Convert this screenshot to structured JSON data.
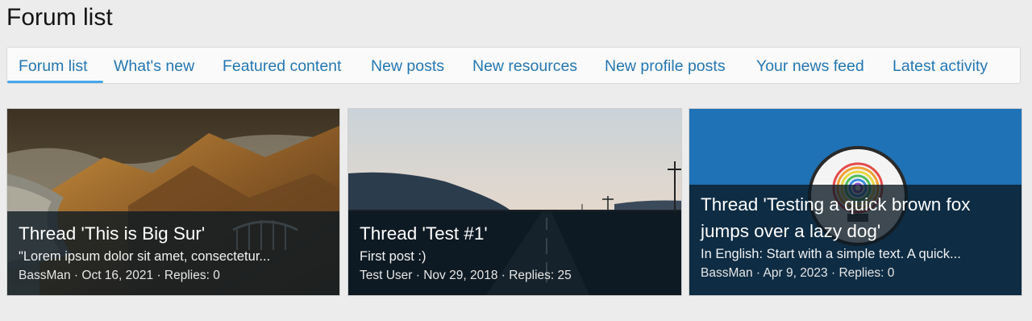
{
  "page": {
    "title": "Forum list"
  },
  "tabs": [
    {
      "label": "Forum list",
      "active": true
    },
    {
      "label": "What's new"
    },
    {
      "label": "Featured content"
    },
    {
      "label": "New posts"
    },
    {
      "label": "New resources"
    },
    {
      "label": "New profile posts"
    },
    {
      "label": "Your news feed"
    },
    {
      "label": "Latest activity"
    }
  ],
  "cards": [
    {
      "title": "Thread 'This is Big Sur'",
      "snippet": "\"Lorem ipsum dolor sit amet, consectetur...",
      "meta": "BassMan · Oct 16, 2021 · Replies: 0",
      "image": "mountain-coast-landscape"
    },
    {
      "title": "Thread 'Test #1'",
      "snippet": "First post :)",
      "meta": "Test User · Nov 29, 2018 · Replies: 25",
      "image": "road-at-sunset"
    },
    {
      "title_line1": "Thread 'Testing a quick brown fox",
      "title_line2": "jumps over a lazy dog'",
      "snippet": "In English: Start with a simple text. A quick...",
      "meta": "BassMan · Apr 9, 2023 · Replies: 0",
      "image": "lightbulb-fingerprint-logo"
    }
  ],
  "colors": {
    "background": "#ececec",
    "link": "#2577b1",
    "tab_underline": "#47a7eb",
    "card3_bg": "#1f72b5",
    "overlay": "rgba(10,24,34,0.78)"
  }
}
